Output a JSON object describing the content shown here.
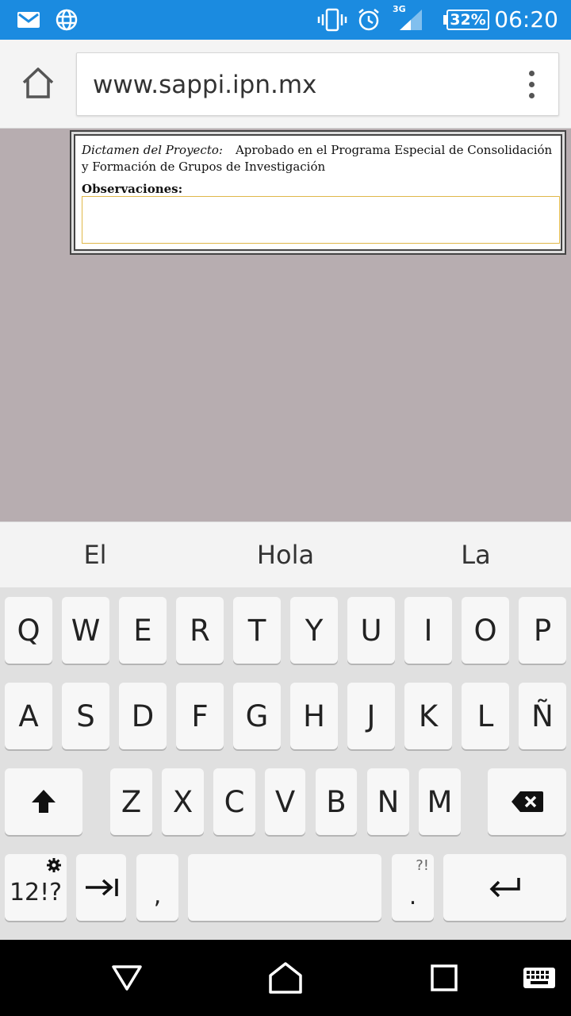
{
  "status_bar": {
    "time": "06:20",
    "battery": "32%",
    "network": "3G",
    "icons": [
      "gmail-icon",
      "globe-icon",
      "vibrate-icon",
      "alarm-icon",
      "signal-icon",
      "battery-icon"
    ]
  },
  "browser": {
    "url": "www.sappi.ipn.mx",
    "home_icon": "home-icon",
    "menu_icon": "overflow-menu-icon"
  },
  "page": {
    "dictamen_label": "Dictamen del Proyecto:",
    "dictamen_value": "Aprobado en el Programa Especial de Consolidación y Formación de Grupos de Investigación",
    "observaciones_label": "Observaciones:",
    "observaciones_value": ""
  },
  "keyboard": {
    "suggestions": [
      "El",
      "Hola",
      "La"
    ],
    "row1": [
      "Q",
      "W",
      "E",
      "R",
      "T",
      "Y",
      "U",
      "I",
      "O",
      "P"
    ],
    "row2": [
      "A",
      "S",
      "D",
      "F",
      "G",
      "H",
      "J",
      "K",
      "L",
      "Ñ"
    ],
    "row3": [
      "Z",
      "X",
      "C",
      "V",
      "B",
      "N",
      "M"
    ],
    "symbols_key": "12!?",
    "comma_key": ",",
    "period_key": ".",
    "period_hint": "?!"
  },
  "nav": {
    "icons": [
      "back-icon",
      "home-icon",
      "recents-icon",
      "keyboard-switch-icon"
    ]
  },
  "colors": {
    "status_bar": "#1b8be0",
    "page_background": "#b7adb0",
    "keyboard_background": "#e0e0e0",
    "key": "#f7f7f7",
    "textarea_focus": "#e0b84a"
  }
}
